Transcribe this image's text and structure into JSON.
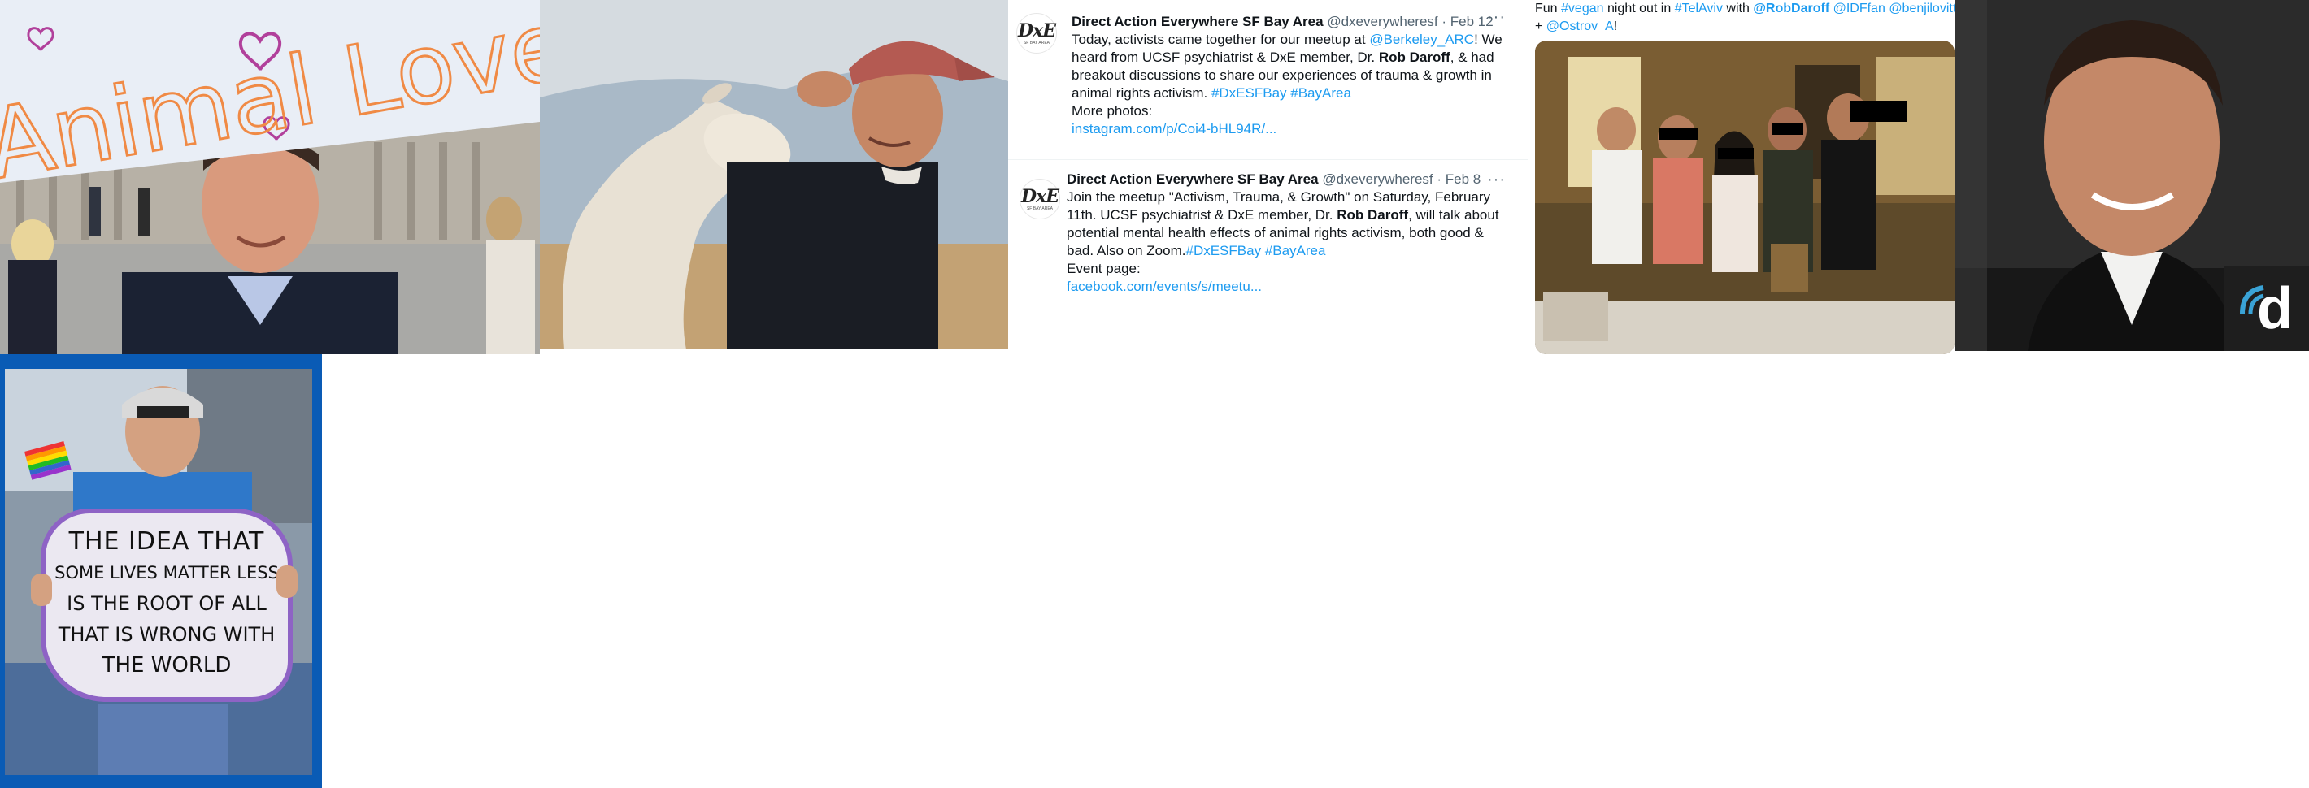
{
  "photo1": {
    "sign_text": "Animal Lovers"
  },
  "photo5": {
    "logo_letter": "d"
  },
  "photo6": {
    "sign_lines": [
      "THE IDEA THAT",
      "SOME LIVES MATTER LESS",
      "IS THE ROOT OF ALL",
      "THAT IS WRONG WITH",
      "THE WORLD"
    ]
  },
  "tweets": [
    {
      "name": "Direct Action Everywhere SF Bay Area",
      "handle": "@dxeverywheresf",
      "date": "· Feb 12",
      "more": "···",
      "avatar_mark": "DxE",
      "avatar_sub": "SF BAY AREA",
      "text_a": "Today, activists came together for our meetup at ",
      "mention": "@Berkeley_ARC",
      "text_b": "! We heard from UCSF psychiatrist & DxE member, Dr. ",
      "bold": "Rob Daroff",
      "text_c": ", & had breakout discussions to share our experiences of trauma & growth in animal rights activism. ",
      "hashtags": "#DxESFBay #BayArea",
      "more_label": "More photos:",
      "link": "instagram.com/p/Coi4-bHL94R/..."
    },
    {
      "name": "Direct Action Everywhere SF Bay Area",
      "handle": "@dxeverywheresf",
      "date": "· Feb 8",
      "more": "···",
      "avatar_mark": "DxE",
      "avatar_sub": "SF BAY AREA",
      "text_a": "Join the meetup \"Activism, Trauma, & Growth\" on Saturday, February 11th. UCSF psychiatrist & DxE member, Dr. ",
      "bold": "Rob Daroff",
      "text_b": ", will talk about potential mental health effects of animal rights activism, both good & bad. Also on Zoom.",
      "hashtags": "#DxESFBay #BayArea",
      "more_label": "Event page:",
      "link": "facebook.com/events/s/meetu..."
    }
  ],
  "caption": {
    "t1": "Fun ",
    "h1": "#vegan",
    "t2": " night out in ",
    "h2": "#TelAviv",
    "t3": " with ",
    "m1": "@RobDaroff",
    "m2": "@IDFfan",
    "m3": "@benjilovitt",
    "t4": "+ ",
    "m4": "@Ostrov_A",
    "t5": "!"
  }
}
